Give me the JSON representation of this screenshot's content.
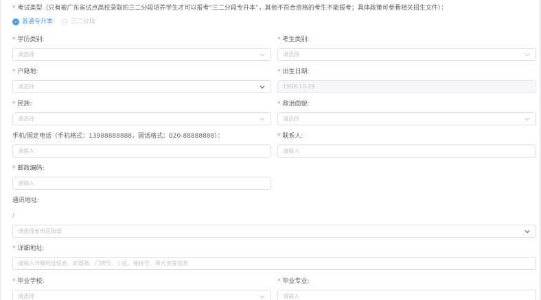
{
  "exam_type": {
    "label": "考试类型（只有被广东省试点高校录取的三二分段培养学生才可以报考“三二分段专升本”，其他不符合资格的考生不能报考；具体政策可参看相关招生文件）：",
    "options": [
      {
        "label": "普通专升本",
        "selected": true
      },
      {
        "label": "三二分段",
        "selected": false,
        "disabled": true
      }
    ]
  },
  "fields": {
    "education_type": {
      "label": "学历类别:",
      "placeholder": "请选择",
      "required": true
    },
    "candidate_type": {
      "label": "考生类别:",
      "placeholder": "请选择",
      "required": true
    },
    "household": {
      "label": "户籍地:",
      "placeholder": "请选择",
      "required": true
    },
    "birth_date": {
      "label": "出生日期:",
      "value": "1998-10-29",
      "required": true,
      "disabled": true
    },
    "ethnicity": {
      "label": "民族:",
      "placeholder": "请选择",
      "required": true
    },
    "political_status": {
      "label": "政治面貌:",
      "placeholder": "请选择",
      "required": true
    },
    "phone": {
      "label": "手机/固定电话（手机格式：13988888888，固话格式：020-88888888）：",
      "placeholder": "请输入",
      "required": false
    },
    "contact_person": {
      "label": "联系人:",
      "placeholder": "请输入",
      "required": true
    },
    "postcode": {
      "label": "邮政编码:",
      "placeholder": "请输入",
      "required": true
    },
    "address": {
      "label": "通讯地址:",
      "separator": "/",
      "placeholder": "请选择省市区街道",
      "required": false
    },
    "detail_address": {
      "label": "详细地址:",
      "placeholder": "请输入详细地址信息，如道路、门牌号、小区、楼栋号、单元室等信息",
      "required": true
    },
    "school": {
      "label": "毕业学校:",
      "placeholder": "请选择",
      "required": true
    },
    "major": {
      "label": "毕业专业:",
      "placeholder": "请输入",
      "required": true
    }
  },
  "colors": {
    "required": "#f56c6c",
    "accent": "#409eff",
    "placeholder": "#c0c4cc",
    "border": "#dcdfe6"
  }
}
